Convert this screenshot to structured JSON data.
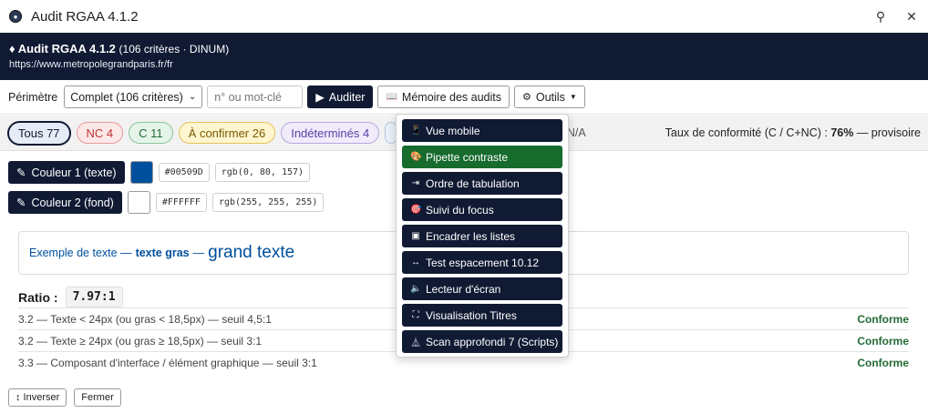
{
  "window": {
    "title": "Audit RGAA 4.1.2",
    "pin_glyph": "⚲",
    "close_glyph": "✕"
  },
  "header": {
    "title": "♦ Audit RGAA 4.1.2",
    "subtitle": "(106 critères · DINUM)",
    "url": "https://www.metropolegrandparis.fr/fr"
  },
  "toolbar": {
    "perimeter_label": "Périmètre",
    "perimeter_value": "Complet (106 critères)",
    "search_placeholder": "n° ou mot-clé",
    "audit_label": "Auditer",
    "audit_icon": "▶",
    "memory_label": "Mémoire des audits",
    "memory_icon": "📖",
    "tools_label": "Outils",
    "tools_icon": "⚙"
  },
  "filters": {
    "all": "Tous 77",
    "nc": "NC 4",
    "c": "C 11",
    "to_confirm": "À confirmer 26",
    "undetermined": "Indéterminés 4",
    "na": "r N/A",
    "rate_label": "Taux de conformité (C / C+NC) :",
    "rate_value": "76%",
    "rate_suffix": "— provisoire"
  },
  "colors": {
    "color1": {
      "label": "Couleur 1 (texte)",
      "hex": "#00509D",
      "rgb": "rgb(0, 80, 157)"
    },
    "color2": {
      "label": "Couleur 2 (fond)",
      "hex": "#FFFFFF",
      "rgb": "rgb(255, 255, 255)"
    },
    "pencil_icon": "✎"
  },
  "preview": {
    "normal": "Exemple de texte —",
    "bold": "texte gras",
    "dash": "—",
    "large": "grand texte"
  },
  "ratio": {
    "label": "Ratio :",
    "value": "7.97:1"
  },
  "criteria": [
    {
      "text": "3.2 — Texte < 24px (ou gras < 18,5px) — seuil 4,5:1",
      "status": "Conforme"
    },
    {
      "text": "3.2 — Texte ≥ 24px (ou gras ≥ 18,5px) — seuil 3:1",
      "status": "Conforme"
    },
    {
      "text": "3.3 — Composant d'interface / élément graphique — seuil 3:1",
      "status": "Conforme"
    }
  ],
  "bottom": {
    "invert": "↕ Inverser",
    "close": "Fermer"
  },
  "tools_menu": [
    {
      "label": "Vue mobile",
      "icon": "📱"
    },
    {
      "label": "Pipette contraste",
      "icon": "🎨",
      "active": true
    },
    {
      "label": "Ordre de tabulation",
      "icon": "⇥"
    },
    {
      "label": "Suivi du focus",
      "icon": "🎯"
    },
    {
      "label": "Encadrer les listes",
      "icon": "▣"
    },
    {
      "label": "Test espacement 10.12",
      "icon": "↔"
    },
    {
      "label": "Lecteur d'écran",
      "icon": "🔈"
    },
    {
      "label": "Visualisation Titres",
      "icon": "⛶"
    },
    {
      "label": "Scan approfondi 7 (Scripts)",
      "icon": "⏅"
    }
  ]
}
